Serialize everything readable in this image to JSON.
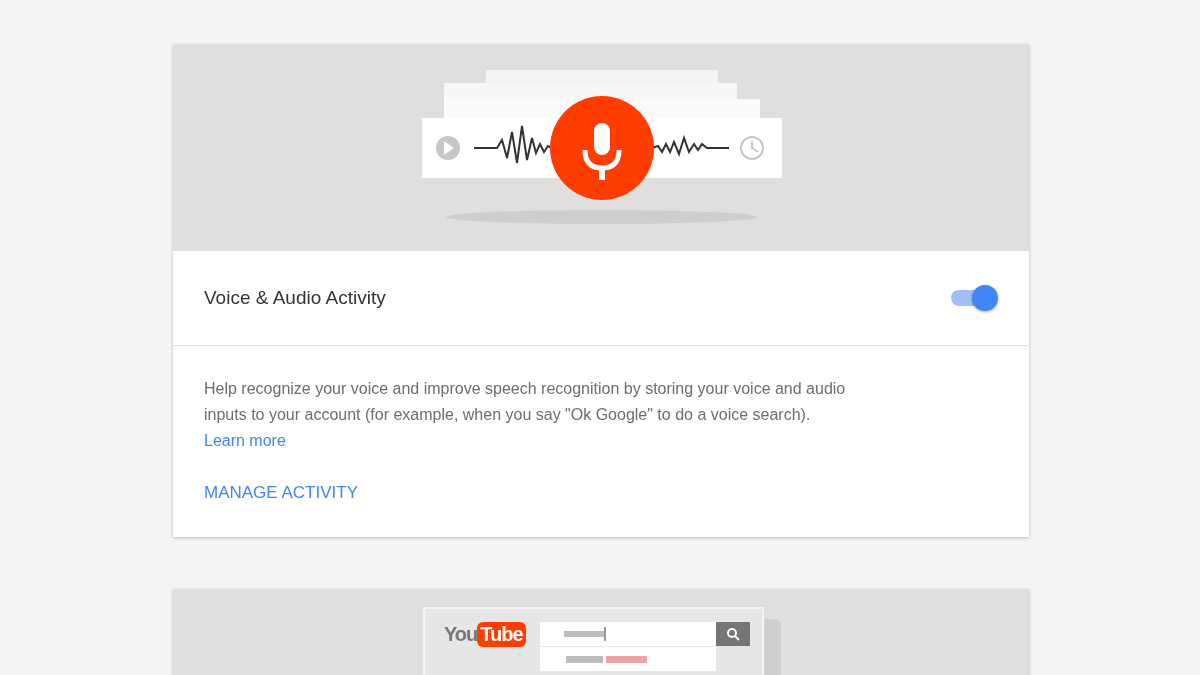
{
  "cards": [
    {
      "kind": "voice",
      "title": "Voice & Audio Activity",
      "on": true,
      "description": "Help recognize your voice and improve speech recognition by storing your voice and audio inputs to your account (for example, when you say \"Ok Google\" to do a voice search).",
      "learn_more": "Learn more",
      "action": "MANAGE ACTIVITY"
    },
    {
      "kind": "youtube",
      "logo_you": "You",
      "logo_tube": "Tube"
    }
  ]
}
